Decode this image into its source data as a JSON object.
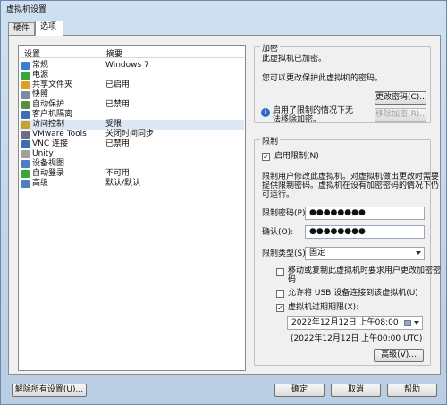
{
  "window": {
    "title": "虚拟机设置"
  },
  "tabs": [
    {
      "label": "硬件"
    },
    {
      "label": "选项"
    }
  ],
  "list": {
    "headers": {
      "setting": "设置",
      "summary": "摘要"
    },
    "rows": [
      {
        "name": "常规",
        "value": "Windows 7",
        "color": "#3b7fd1"
      },
      {
        "name": "电源",
        "value": "",
        "color": "#3aa53a"
      },
      {
        "name": "共享文件夹",
        "value": "已启用",
        "color": "#e0a020"
      },
      {
        "name": "快照",
        "value": "",
        "color": "#7a8aa0"
      },
      {
        "name": "自动保护",
        "value": "已禁用",
        "color": "#5a8f3c"
      },
      {
        "name": "客户机隔离",
        "value": "",
        "color": "#3d6fb0"
      },
      {
        "name": "访问控制",
        "value": "受限",
        "color": "#c8a030"
      },
      {
        "name": "VMware Tools",
        "value": "关闭时间同步",
        "color": "#6c6c8c"
      },
      {
        "name": "VNC 连接",
        "value": "已禁用",
        "color": "#3d6fb0"
      },
      {
        "name": "Unity",
        "value": "",
        "color": "#a0a0a0"
      },
      {
        "name": "设备视图",
        "value": "",
        "color": "#4a7fc0"
      },
      {
        "name": "自动登录",
        "value": "不可用",
        "color": "#3aa53a"
      },
      {
        "name": "高级",
        "value": "默认/默认",
        "color": "#4a7fc0"
      }
    ]
  },
  "encryption": {
    "title": "加密",
    "status": "此虚拟机已加密。",
    "desc": "您可以更改保护此虚拟机的密码。",
    "change_pw_button": "更改密码(C)...",
    "info_text_1": "启用了限制的情况下无",
    "info_text_2": "法移除加密。",
    "remove_button": "移除加密(R)..."
  },
  "restrictions": {
    "title": "限制",
    "enable_label": "启用限制(N)",
    "desc_1": "限制用户修改此虚拟机。对虚拟机做出更改时需要",
    "desc_2": "提供限制密码。虚拟机在设有加密密码的情况下仍",
    "desc_3": "可运行。",
    "pw_label": "限制密码(P):",
    "pw_value": "●●●●●●●●",
    "confirm_label": "确认(O):",
    "confirm_value": "●●●●●●●●",
    "type_label": "限制类型(S):",
    "type_value": "固定",
    "opt1_1": "移动或复制此虚拟机时要求用户更改加密密",
    "opt1_2": "码",
    "opt2": "允许将 USB 设备连接到该虚拟机(U)",
    "opt3": "虚拟机过期期限(X):",
    "expire_date": "2022年12月12日 上午08:00",
    "expire_utc": "(2022年12月12日 上午00:00 UTC)",
    "advanced_button": "高级(V)..."
  },
  "footer": {
    "reset_button": "解除所有设置(U)...",
    "ok_button": "确定",
    "cancel_button": "取消",
    "help_button": "帮助"
  }
}
